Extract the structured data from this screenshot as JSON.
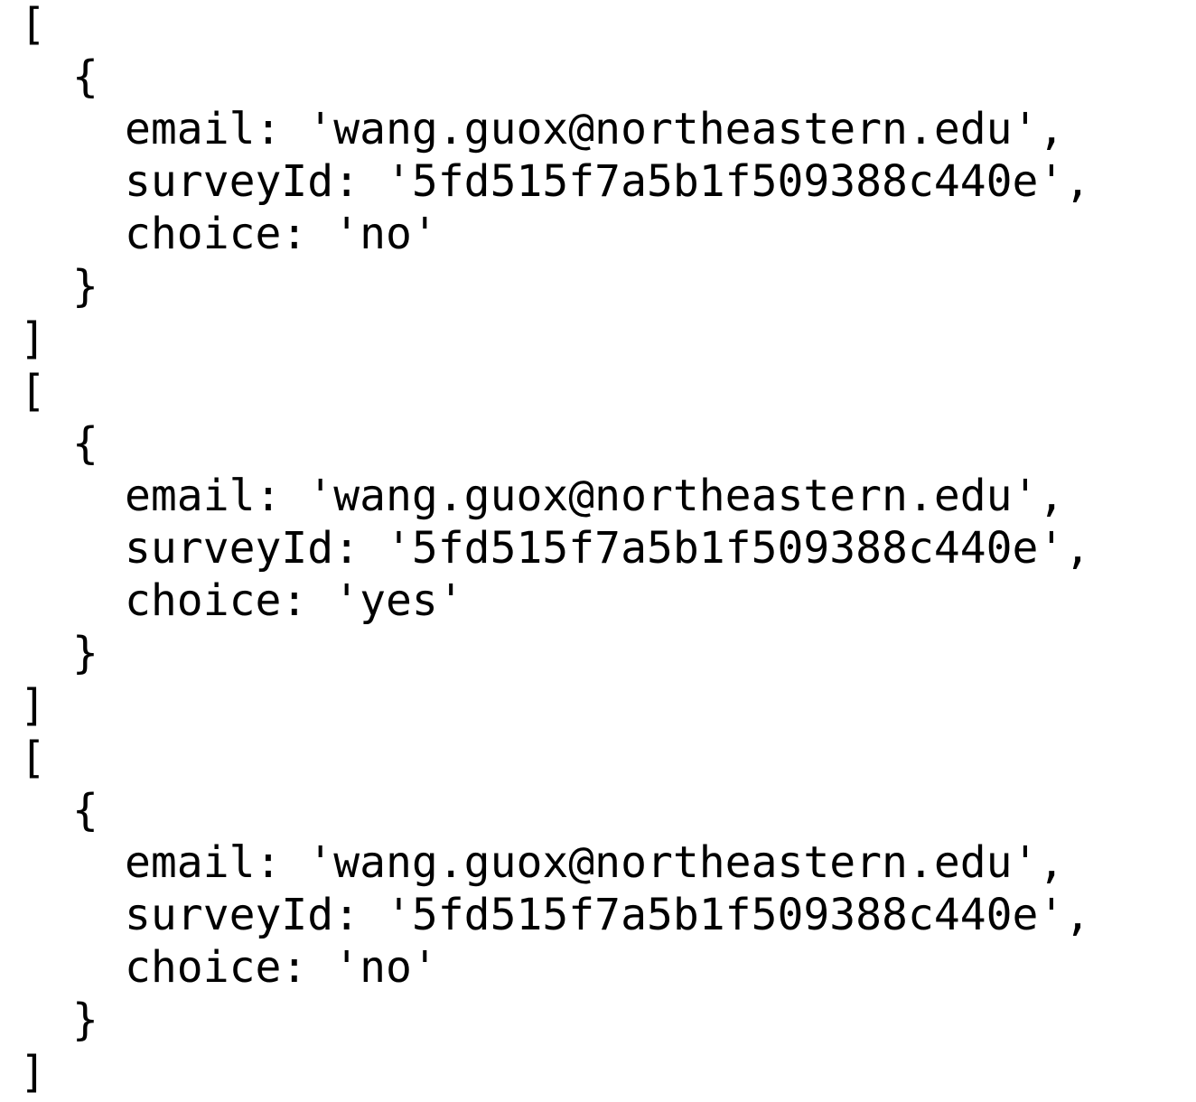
{
  "records": [
    {
      "open_bracket": "[",
      "open_brace": "{",
      "email_line": "email: 'wang.guox@northeastern.edu',",
      "survey_line": "surveyId: '5fd515f7a5b1f509388c440e',",
      "choice_line": "choice: 'no'",
      "close_brace": "}",
      "close_bracket": "]"
    },
    {
      "open_bracket": "[",
      "open_brace": "{",
      "email_line": "email: 'wang.guox@northeastern.edu',",
      "survey_line": "surveyId: '5fd515f7a5b1f509388c440e',",
      "choice_line": "choice: 'yes'",
      "close_brace": "}",
      "close_bracket": "]"
    },
    {
      "open_bracket": "[",
      "open_brace": "{",
      "email_line": "email: 'wang.guox@northeastern.edu',",
      "survey_line": "surveyId: '5fd515f7a5b1f509388c440e',",
      "choice_line": "choice: 'no'",
      "close_brace": "}",
      "close_bracket": "]"
    }
  ]
}
